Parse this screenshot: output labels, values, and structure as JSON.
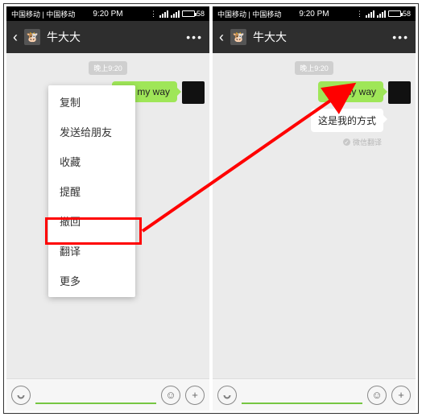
{
  "status": {
    "carrier": "中国移动 | 中国移动",
    "time": "9:20 PM",
    "battery": "58"
  },
  "header": {
    "title": "牛大大"
  },
  "chat": {
    "timestamp": "晚上9:20",
    "message": "this my way",
    "translation": "这是我的方式",
    "translation_source": "微信翻译"
  },
  "menu": {
    "items": [
      "复制",
      "发送给朋友",
      "收藏",
      "提醒",
      "撤回",
      "翻译",
      "更多"
    ]
  }
}
